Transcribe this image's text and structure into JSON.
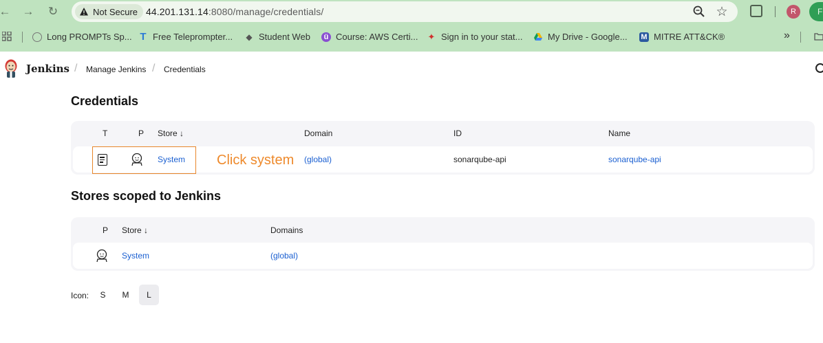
{
  "browser": {
    "security_label": "Not Secure",
    "url_host": "44.201.131.14",
    "url_path": ":8080/manage/credentials/",
    "profile_initial": "R",
    "profile_chip": "Fi",
    "bookmarks": [
      {
        "label": "Long PROMPTs Sp..."
      },
      {
        "label": "Free Teleprompter..."
      },
      {
        "label": "Student Web"
      },
      {
        "label": "Course: AWS Certi..."
      },
      {
        "label": "Sign in to your stat..."
      },
      {
        "label": "My Drive - Google..."
      },
      {
        "label": "MITRE ATT&CK®"
      }
    ],
    "bookmarks_overflow": "»"
  },
  "header": {
    "brand": "Jenkins",
    "breadcrumbs": [
      "Manage Jenkins",
      "Credentials"
    ]
  },
  "credentials": {
    "title": "Credentials",
    "columns": {
      "t": "T",
      "p": "P",
      "store": "Store ↓",
      "domain": "Domain",
      "id": "ID",
      "name": "Name"
    },
    "rows": [
      {
        "store": "System",
        "domain": "(global)",
        "id": "sonarqube-api",
        "name": "sonarqube-api"
      }
    ],
    "annotation": "Click system"
  },
  "stores": {
    "title": "Stores scoped to Jenkins",
    "columns": {
      "p": "P",
      "store": "Store ↓",
      "domains": "Domains"
    },
    "rows": [
      {
        "store": "System",
        "domains": "(global)"
      }
    ]
  },
  "icon_size": {
    "label": "Icon:",
    "options": [
      "S",
      "M",
      "L"
    ],
    "selected": "L"
  },
  "colors": {
    "chrome_bg": "#bfe3bf",
    "link": "#1a5fd1",
    "annotation": "#ee8a2c"
  }
}
